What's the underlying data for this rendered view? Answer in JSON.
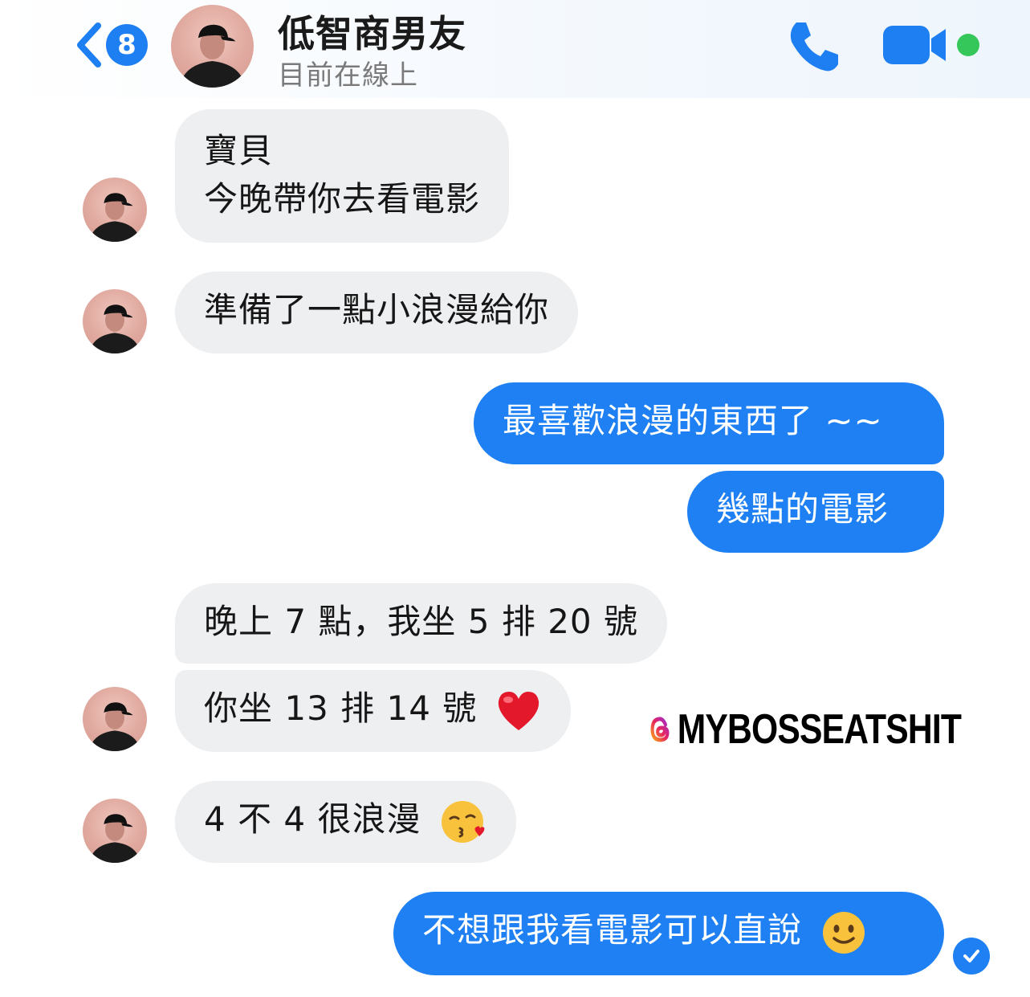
{
  "header": {
    "back_count": "8",
    "contact_name": "低智商男友",
    "status": "目前在線上"
  },
  "colors": {
    "accent": "#1e80f3",
    "incoming_bubble": "#eeeff1",
    "online": "#35c759"
  },
  "icons": [
    "chevron-left-icon",
    "phone-icon",
    "video-camera-icon",
    "read-receipt-check-icon",
    "heart-emoji",
    "kissing-emoji",
    "smiling-emoji",
    "threads-logo-icon"
  ],
  "messages": [
    {
      "from": "them",
      "line1": "寶貝",
      "line2": "今晚帶你去看電影"
    },
    {
      "from": "them",
      "text": "準備了一點小浪漫給你"
    },
    {
      "from": "me",
      "text": "最喜歡浪漫的東西了 ~~"
    },
    {
      "from": "me",
      "text": "幾點的電影"
    },
    {
      "from": "them",
      "text": "晚上 7 點，我坐 5 排 20 號"
    },
    {
      "from": "them",
      "text": "你坐 13 排 14 號"
    },
    {
      "from": "them",
      "text": "4 不 4 很浪漫"
    },
    {
      "from": "me",
      "text": "不想跟我看電影可以直說"
    }
  ],
  "watermark": "MYBOSSEATSHIT"
}
